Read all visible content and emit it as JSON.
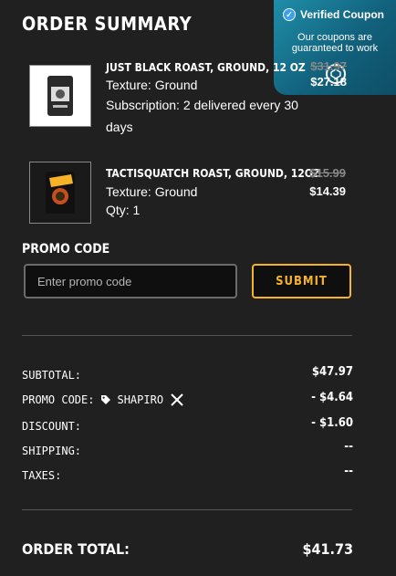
{
  "title": "ORDER SUMMARY",
  "coupon_badge": {
    "heading": "Verified Coupon",
    "body": "Our coupons are guaranteed to work"
  },
  "items": [
    {
      "name": "JUST BLACK ROAST, GROUND, 12 OZ",
      "texture": "Texture: Ground",
      "extra": "Subscription: 2 delivered every 30 days",
      "price_old": "$31.97",
      "price_new": "$27.18"
    },
    {
      "name": "TACTISQUATCH ROAST, GROUND, 12OZ",
      "texture": "Texture: Ground",
      "extra": "Qty: 1",
      "price_old": "$15.99",
      "price_new": "$14.39"
    }
  ],
  "promo": {
    "label": "PROMO CODE",
    "placeholder": "Enter promo code",
    "submit_label": "SUBMIT"
  },
  "summary": {
    "subtotal_label": "SUBTOTAL:",
    "subtotal_value": "$47.97",
    "promo_label": "PROMO CODE:",
    "promo_code": "SHAPIRO",
    "promo_value": "- $4.64",
    "discount_label": "DISCOUNT:",
    "discount_value": "- $1.60",
    "shipping_label": "SHIPPING:",
    "shipping_value": "--",
    "taxes_label": "TAXES:",
    "taxes_value": "--",
    "total_label": "ORDER TOTAL:",
    "total_value": "$41.73"
  },
  "colors": {
    "background": "#202020",
    "accent": "#f6b328",
    "coupon_badge": "#12617c"
  }
}
